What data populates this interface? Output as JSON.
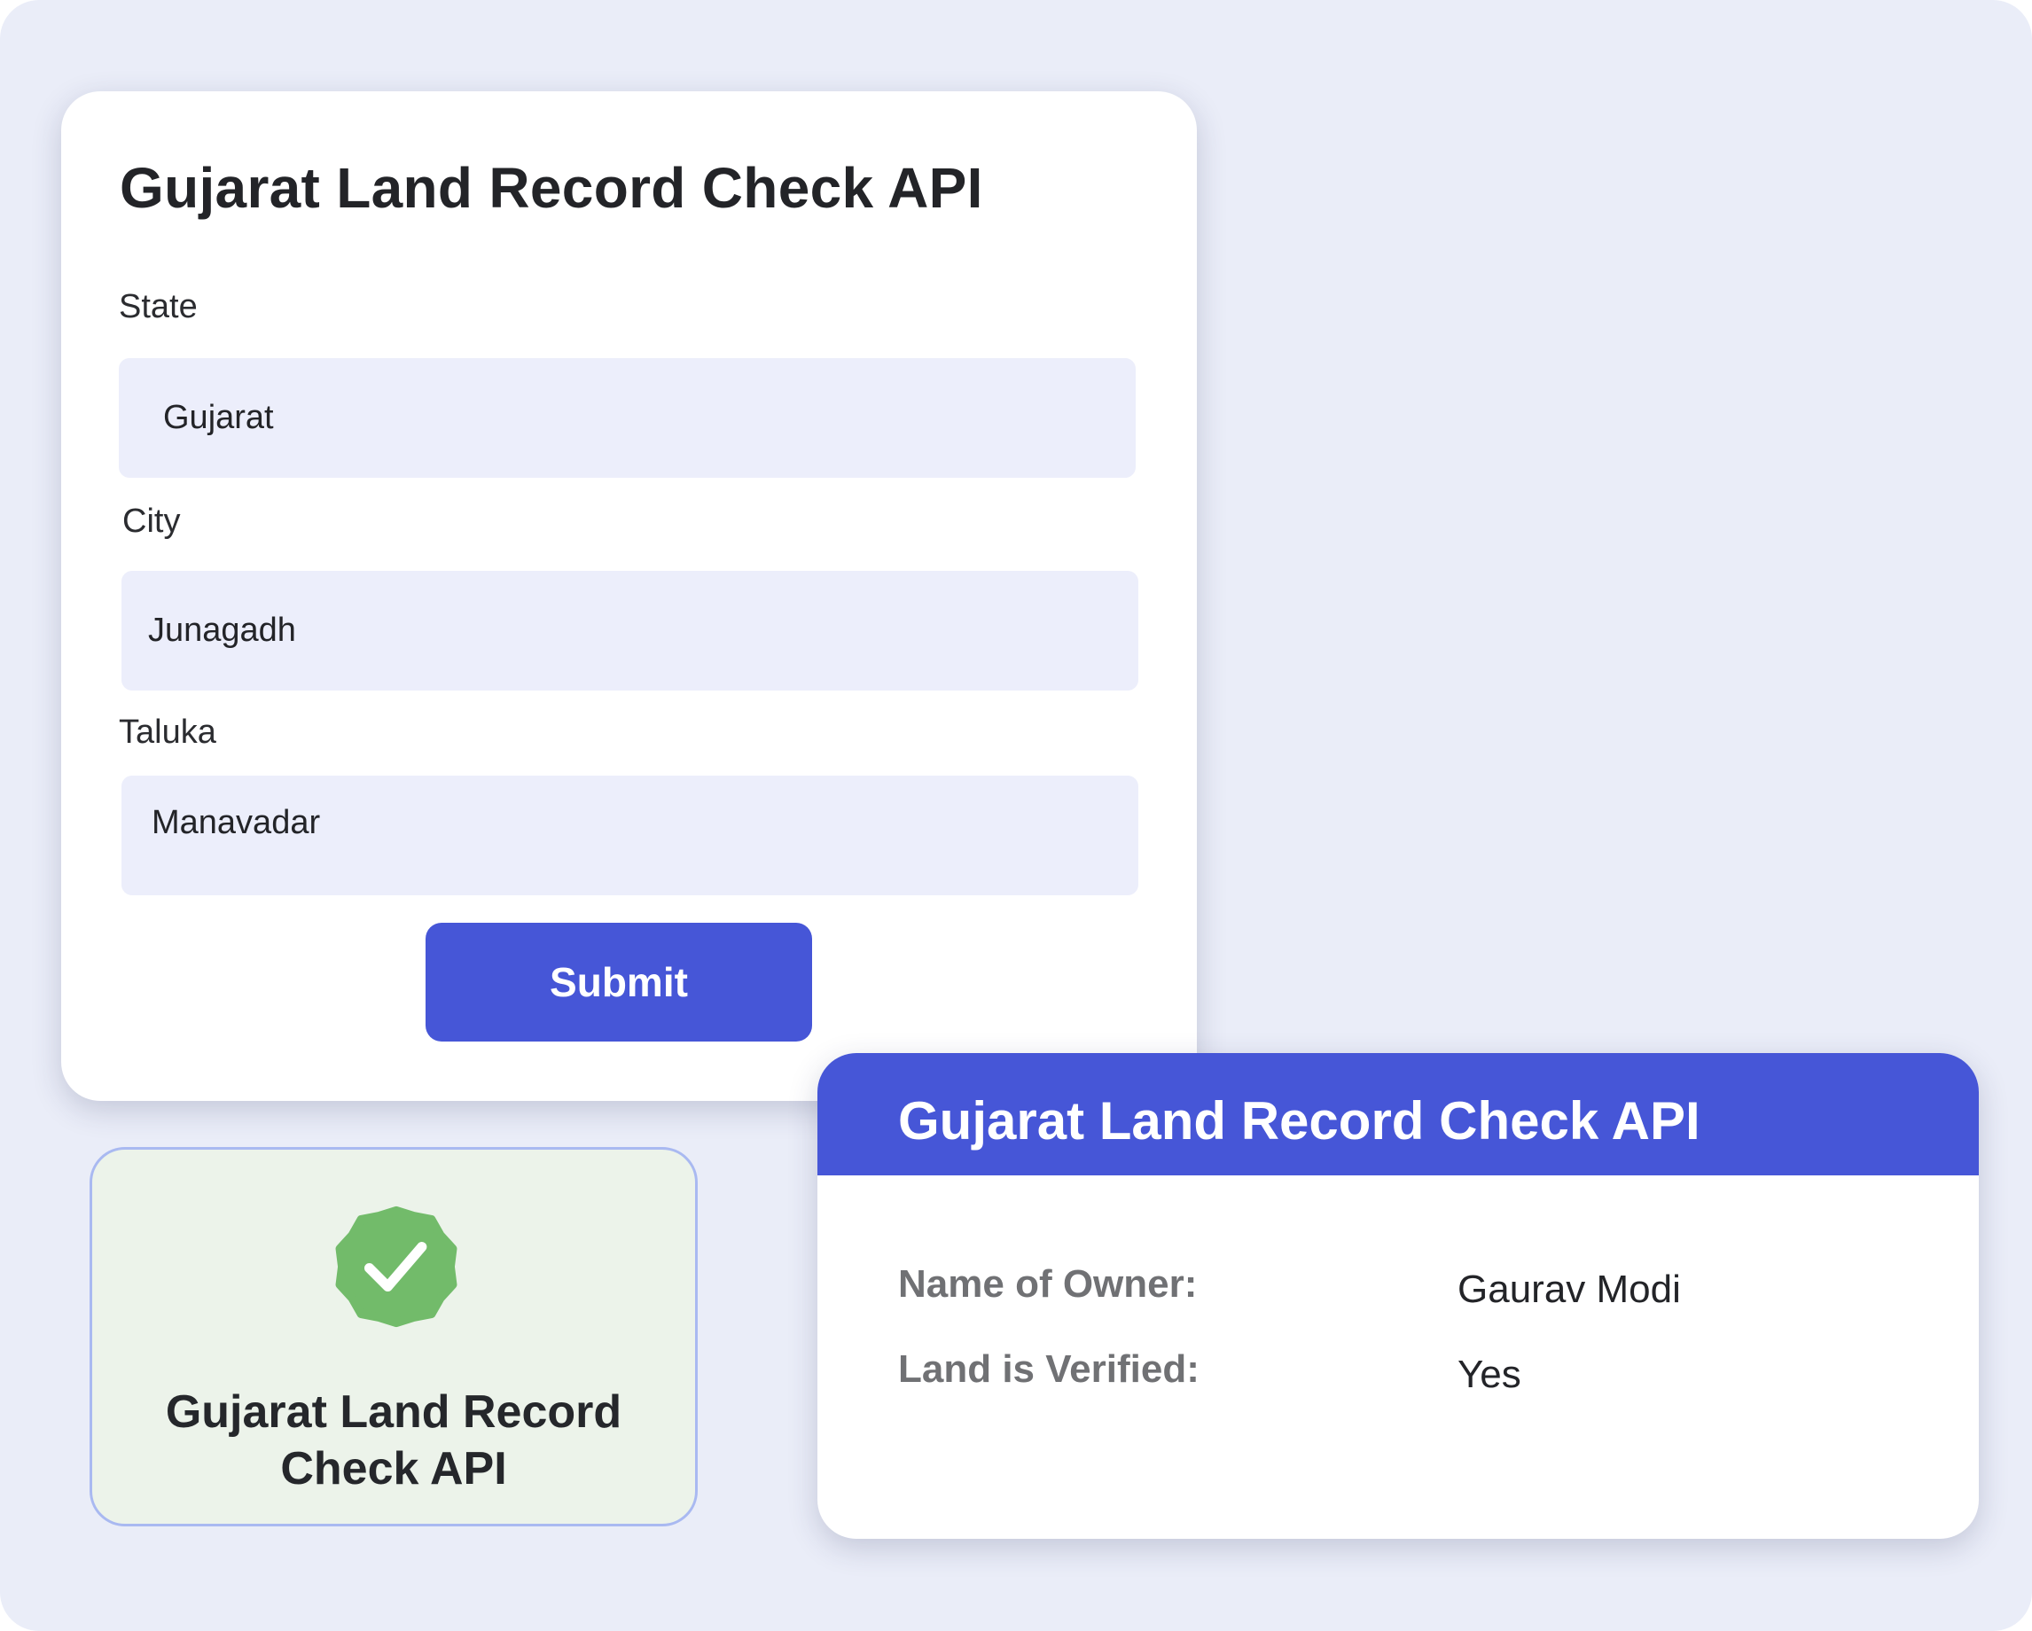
{
  "form": {
    "title": "Gujarat Land Record Check API",
    "fields": {
      "state": {
        "label": "State",
        "value": "Gujarat"
      },
      "city": {
        "label": "City",
        "value": "Junagadh"
      },
      "taluka": {
        "label": "Taluka",
        "value": "Manavadar"
      }
    },
    "submit_label": "Submit"
  },
  "badge": {
    "icon": "verified-check-icon",
    "title": "Gujarat Land Record Check API",
    "color": "#72bb6a"
  },
  "result": {
    "title": "Gujarat Land Record Check API",
    "rows": [
      {
        "label": "Name of Owner:",
        "value": "Gaurav Modi"
      },
      {
        "label": "Land is Verified:",
        "value": "Yes"
      }
    ]
  },
  "colors": {
    "accent": "#4656d7",
    "background": "#eaedf8",
    "input_background": "#eceefb",
    "badge_background": "#ecf3ea",
    "badge_border": "#a9b9f1"
  }
}
